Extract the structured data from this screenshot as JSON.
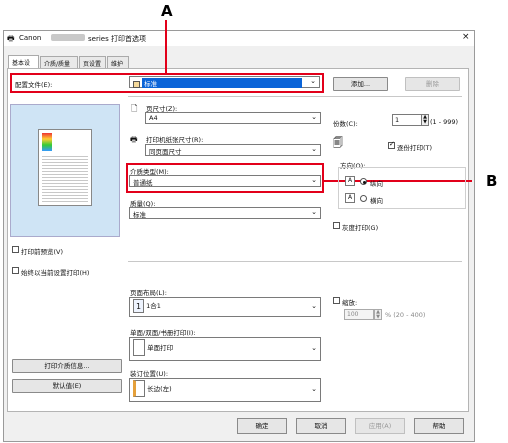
{
  "window": {
    "title": "Canon",
    "title_suffix": "series 打印首选项",
    "close": "×"
  },
  "callouts": {
    "a": "A",
    "b": "B"
  },
  "tabs": [
    "基本设置",
    "介质/质量",
    "页设置",
    "维护"
  ],
  "profile": {
    "label": "配置文件(E):",
    "value": "标准",
    "add": "添加...",
    "delete": "删除"
  },
  "page_size": {
    "label": "页尺寸(Z):",
    "value": "A4"
  },
  "printer_paper_size": {
    "label": "打印机纸张尺寸(R):",
    "value": "同页面尺寸"
  },
  "media_type": {
    "label": "介质类型(M):",
    "value": "普通纸"
  },
  "quality": {
    "label": "质量(Q):",
    "value": "标准"
  },
  "copies": {
    "label": "份数(C):",
    "value": "1",
    "range": "(1 - 999)"
  },
  "collate": {
    "label": "逐份打印(T)"
  },
  "orientation": {
    "label": "方向(O):",
    "portrait": "纵向",
    "landscape": "横向"
  },
  "grayscale": {
    "label": "灰度打印(G)"
  },
  "preview": {
    "label": "打印前预览(V)"
  },
  "always_print": {
    "label": "始终以当前设置打印(H)"
  },
  "layout": {
    "label": "页面布局(L):",
    "value": "1合1",
    "icon_text": "1"
  },
  "scaling": {
    "label": "缩放:",
    "value": "100",
    "range": "% (20 - 400)"
  },
  "duplex": {
    "label": "单面/双面/书册打印(I):",
    "value": "单面打印"
  },
  "binding": {
    "label": "装订位置(U):",
    "value": "长边(左)"
  },
  "left_buttons": {
    "media_info": "打印介质信息...",
    "defaults": "默认值(E)"
  },
  "footer": {
    "ok": "确定",
    "cancel": "取消",
    "apply": "应用(A)",
    "help": "帮助"
  },
  "colors": {
    "callout_red": "#e2001a",
    "selection_blue": "#0a64d8"
  }
}
